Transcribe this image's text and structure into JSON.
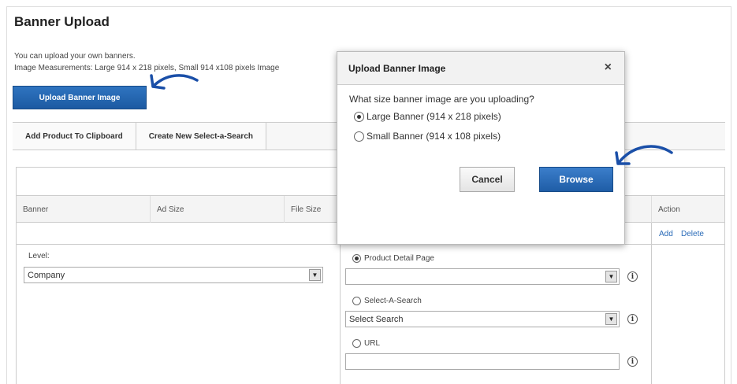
{
  "page": {
    "title": "Banner Upload",
    "intro_line1": "You can upload your own banners.",
    "intro_line2": "Image Measurements: Large 914 x 218 pixels, Small 914 x108 pixels Image",
    "upload_button": "Upload Banner Image"
  },
  "tabs": [
    "Add Product To Clipboard",
    "Create New Select-a-Search"
  ],
  "grid": {
    "headers": [
      "Banner",
      "Ad Size",
      "File Size",
      "Action"
    ],
    "links": {
      "add": "Add",
      "delete": "Delete"
    },
    "level_label": "Level:",
    "level_value": "Company",
    "radio_product": "Product Detail Page",
    "radio_search": "Select-A-Search",
    "search_value": "Select Search",
    "radio_url": "URL"
  },
  "modal": {
    "title": "Upload Banner Image",
    "close": "×",
    "question": "What size banner image are you uploading?",
    "option_large": "Large Banner (914 x 218 pixels)",
    "option_small": "Small Banner (914 x 108 pixels)",
    "selected": "large",
    "cancel": "Cancel",
    "browse": "Browse"
  },
  "colors": {
    "primary_button": "#1f5da6",
    "link": "#2a6bb8",
    "annotation_arrow": "#1a4fa8"
  },
  "icons": [
    "close-icon",
    "chevron-down-icon",
    "info-icon",
    "arrow-annotation-icon"
  ]
}
